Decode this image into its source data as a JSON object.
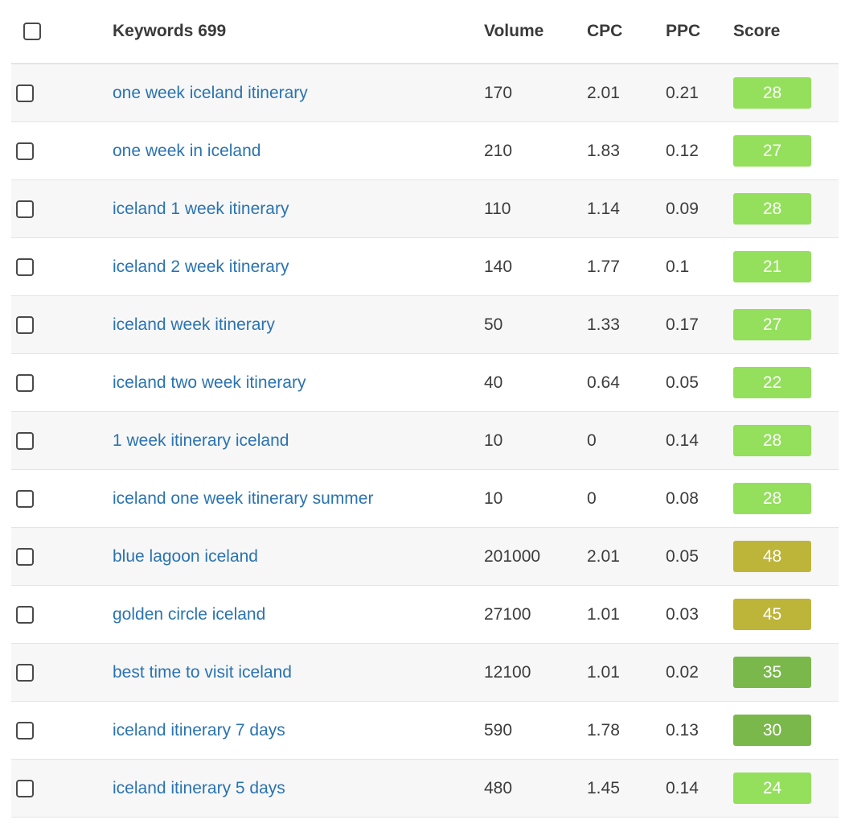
{
  "header": {
    "keywords_label": "Keywords 699",
    "volume_label": "Volume",
    "cpc_label": "CPC",
    "ppc_label": "PPC",
    "score_label": "Score"
  },
  "colors": {
    "low": "#94df5c",
    "mid": "#7ab84b",
    "high": "#bdb53a"
  },
  "rows": [
    {
      "keyword": "one week iceland itinerary",
      "volume": "170",
      "cpc": "2.01",
      "ppc": "0.21",
      "score": "28",
      "score_color": "#94df5c"
    },
    {
      "keyword": "one week in iceland",
      "volume": "210",
      "cpc": "1.83",
      "ppc": "0.12",
      "score": "27",
      "score_color": "#94df5c"
    },
    {
      "keyword": "iceland 1 week itinerary",
      "volume": "110",
      "cpc": "1.14",
      "ppc": "0.09",
      "score": "28",
      "score_color": "#94df5c"
    },
    {
      "keyword": "iceland 2 week itinerary",
      "volume": "140",
      "cpc": "1.77",
      "ppc": "0.1",
      "score": "21",
      "score_color": "#94df5c"
    },
    {
      "keyword": "iceland week itinerary",
      "volume": "50",
      "cpc": "1.33",
      "ppc": "0.17",
      "score": "27",
      "score_color": "#94df5c"
    },
    {
      "keyword": "iceland two week itinerary",
      "volume": "40",
      "cpc": "0.64",
      "ppc": "0.05",
      "score": "22",
      "score_color": "#94df5c"
    },
    {
      "keyword": "1 week itinerary iceland",
      "volume": "10",
      "cpc": "0",
      "ppc": "0.14",
      "score": "28",
      "score_color": "#94df5c"
    },
    {
      "keyword": "iceland one week itinerary summer",
      "volume": "10",
      "cpc": "0",
      "ppc": "0.08",
      "score": "28",
      "score_color": "#94df5c"
    },
    {
      "keyword": "blue lagoon iceland",
      "volume": "201000",
      "cpc": "2.01",
      "ppc": "0.05",
      "score": "48",
      "score_color": "#bdb53a"
    },
    {
      "keyword": "golden circle iceland",
      "volume": "27100",
      "cpc": "1.01",
      "ppc": "0.03",
      "score": "45",
      "score_color": "#bdb53a"
    },
    {
      "keyword": "best time to visit iceland",
      "volume": "12100",
      "cpc": "1.01",
      "ppc": "0.02",
      "score": "35",
      "score_color": "#7ab84b"
    },
    {
      "keyword": "iceland itinerary 7 days",
      "volume": "590",
      "cpc": "1.78",
      "ppc": "0.13",
      "score": "30",
      "score_color": "#7ab84b"
    },
    {
      "keyword": "iceland itinerary 5 days",
      "volume": "480",
      "cpc": "1.45",
      "ppc": "0.14",
      "score": "24",
      "score_color": "#94df5c"
    }
  ]
}
